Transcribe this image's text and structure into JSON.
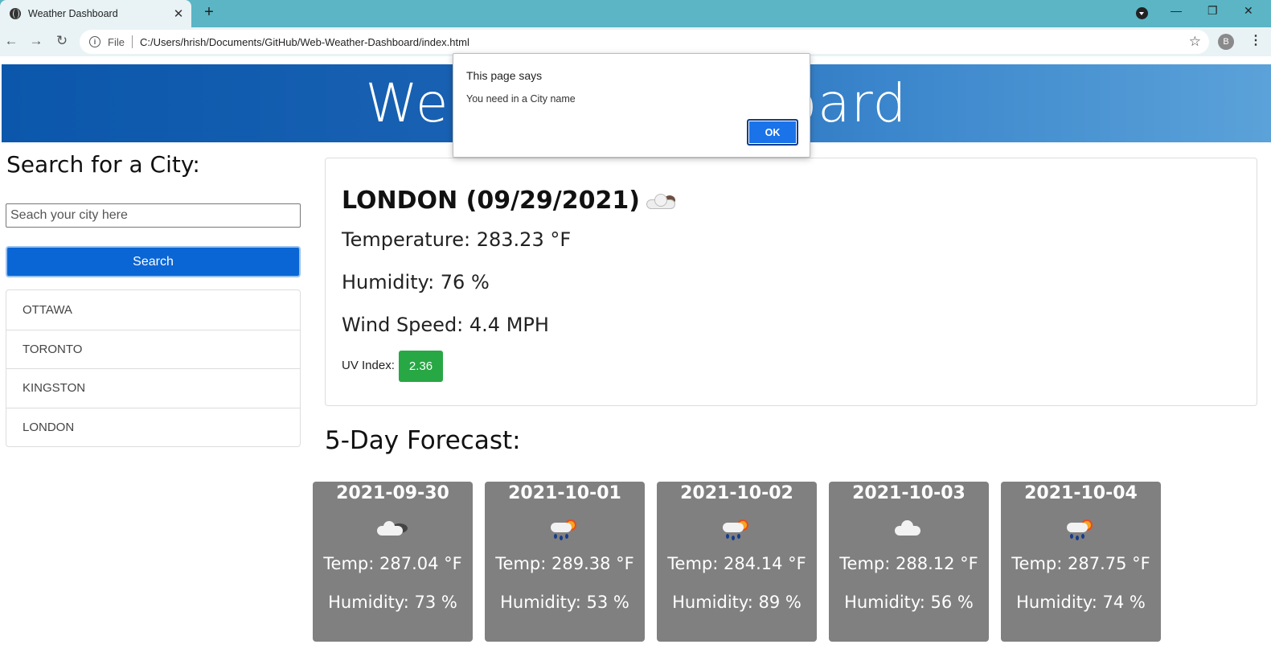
{
  "browser": {
    "tab_title": "Weather Dashboard",
    "tab_close": "✕",
    "new_tab": "+",
    "scheme": "File",
    "url": "C:/Users/hrish/Documents/GitHub/Web-Weather-Dashboard/index.html",
    "avatar_letter": "B",
    "back": "←",
    "forward": "→",
    "reload": "↻",
    "star": "☆",
    "menu": "⋮",
    "win_min": "—",
    "win_restore": "❐",
    "win_close": "✕",
    "info": "i"
  },
  "header": {
    "title": "Weather Dashboard"
  },
  "search": {
    "heading": "Search for a City:",
    "placeholder": "Seach your city here",
    "button_label": "Search"
  },
  "history": [
    "OTTAWA",
    "TORONTO",
    "KINGSTON",
    "LONDON"
  ],
  "current": {
    "title": "LONDON (09/29/2021)",
    "temperature": "Temperature: 283.23 °F",
    "humidity": "Humidity: 76 %",
    "wind": "Wind Speed: 4.4 MPH",
    "uv_label": "UV Index:",
    "uv_value": "2.36",
    "uv_color": "#28a745",
    "icon": "few-clouds-night-icon"
  },
  "forecast": {
    "heading": "5-Day Forecast:",
    "days": [
      {
        "date": "2021-09-30",
        "temp": "Temp: 287.04 °F",
        "humidity": "Humidity: 73 %",
        "icon": "broken-clouds-icon"
      },
      {
        "date": "2021-10-01",
        "temp": "Temp: 289.38 °F",
        "humidity": "Humidity: 53 %",
        "icon": "rain-sun-icon"
      },
      {
        "date": "2021-10-02",
        "temp": "Temp: 284.14 °F",
        "humidity": "Humidity: 89 %",
        "icon": "rain-sun-icon"
      },
      {
        "date": "2021-10-03",
        "temp": "Temp: 288.12 °F",
        "humidity": "Humidity: 56 %",
        "icon": "cloud-icon"
      },
      {
        "date": "2021-10-04",
        "temp": "Temp: 287.75 °F",
        "humidity": "Humidity: 74 %",
        "icon": "rain-sun-icon"
      }
    ]
  },
  "dialog": {
    "title": "This page says",
    "message": "You need in a City name",
    "ok_label": "OK"
  }
}
